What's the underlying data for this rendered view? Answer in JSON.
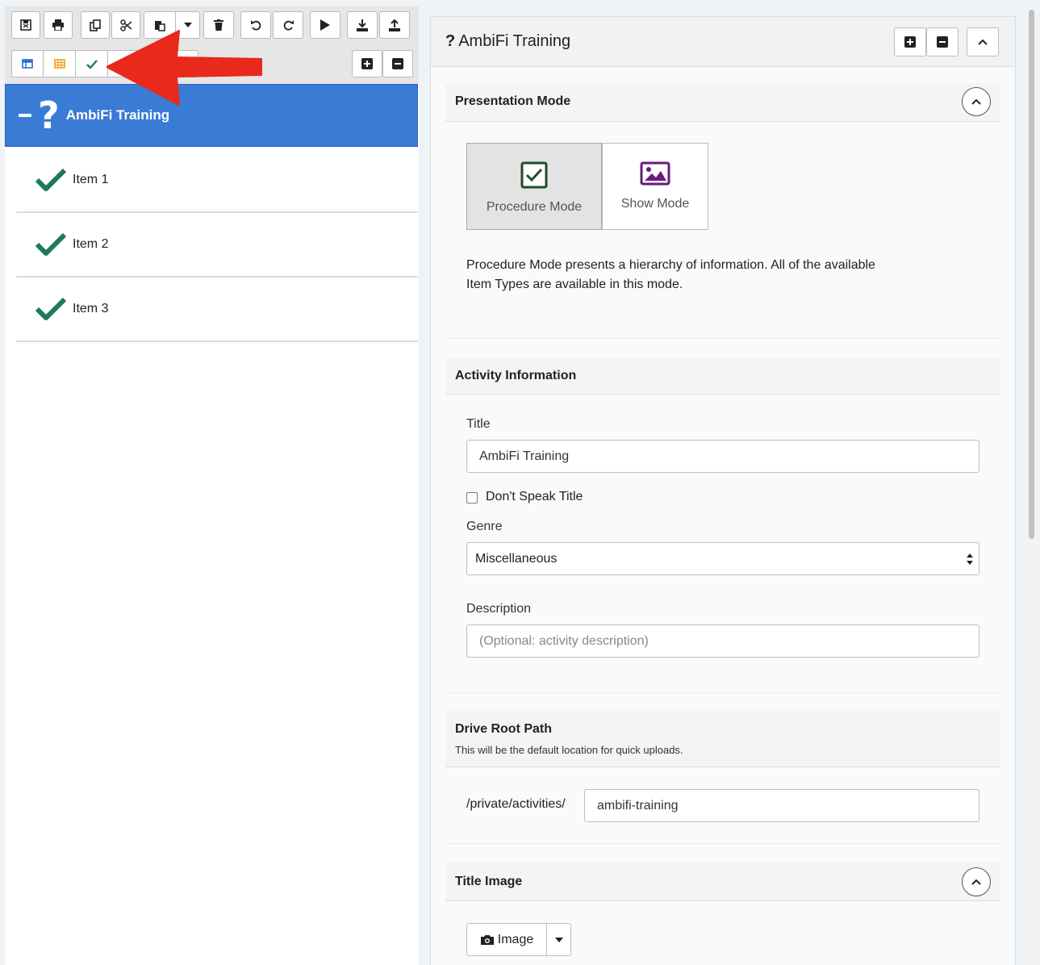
{
  "colors": {
    "selection_blue": "#3a7bd5",
    "check_green": "#1e7a5e",
    "arrow_red": "#e8291c",
    "toolbar_bg": "#e6e6e6"
  },
  "toolbar": {
    "row1_icons": [
      "save-icon",
      "print-icon",
      "copy-icon",
      "cut-icon",
      "paste-icon",
      "dropdown-caret-icon",
      "trash-icon",
      "undo-icon",
      "redo-icon",
      "play-icon",
      "download-icon",
      "upload-icon"
    ],
    "row2_icons": [
      "table-blue-icon",
      "table-orange-icon",
      "checkmark-icon",
      "expand-all-icon",
      "collapse-all-icon"
    ]
  },
  "tree": {
    "root": {
      "label": "AmbiFi Training",
      "icon": "question-icon"
    },
    "items": [
      {
        "label": "Item 1"
      },
      {
        "label": "Item 2"
      },
      {
        "label": "Item 3"
      }
    ]
  },
  "panel": {
    "title": "AmbiFi Training",
    "title_icon": "question-icon"
  },
  "presentation": {
    "heading": "Presentation Mode",
    "modes": [
      {
        "label": "Procedure Mode",
        "active": true,
        "icon": "checkbox-icon"
      },
      {
        "label": "Show Mode",
        "active": false,
        "icon": "image-icon"
      }
    ],
    "description": "Procedure Mode presents a hierarchy of information. All of the available Item Types are available in this mode."
  },
  "activity": {
    "heading": "Activity Information",
    "title_label": "Title",
    "title_value": "AmbiFi Training",
    "dont_speak_label": "Don't Speak Title",
    "dont_speak_checked": false,
    "genre_label": "Genre",
    "genre_value": "Miscellaneous",
    "description_label": "Description",
    "description_placeholder": "(Optional: activity description)"
  },
  "drive": {
    "heading": "Drive Root Path",
    "subtitle": "This will be the default location for quick uploads.",
    "prefix": "/private/activities/",
    "value": "ambifi-training"
  },
  "title_image": {
    "heading": "Title Image",
    "button_label": "Image"
  }
}
